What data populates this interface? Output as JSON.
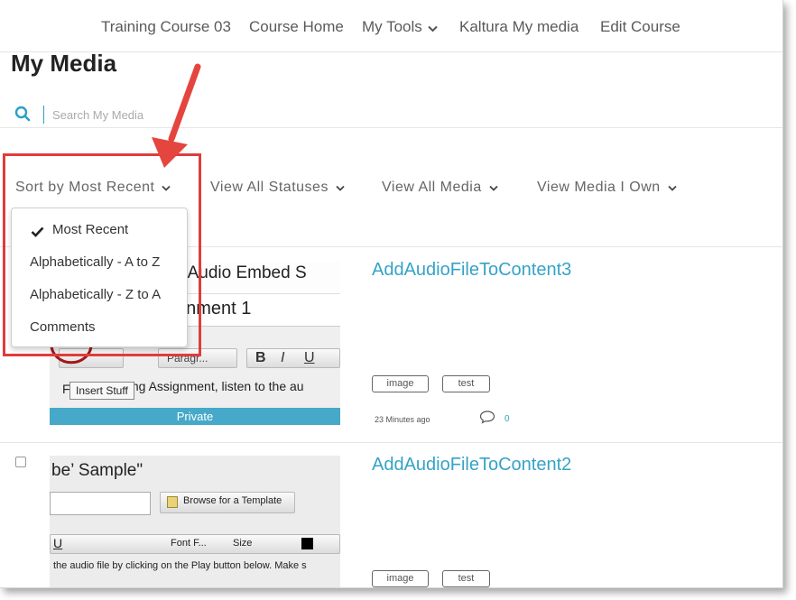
{
  "nav": {
    "items": [
      "Training Course 03",
      "Course Home",
      "My Tools",
      "Kaltura My media",
      "Edit Course"
    ]
  },
  "page": {
    "title": "My Media"
  },
  "search": {
    "placeholder": "Search My Media"
  },
  "filters": {
    "sort": "Sort by Most Recent",
    "statuses": "View All Statuses",
    "media": "View All Media",
    "own": "View Media I Own"
  },
  "sort_menu": {
    "options": [
      "Most Recent",
      "Alphabetically - A to Z",
      "Alphabetically - Z to A",
      "Comments"
    ],
    "selected": "Most Recent"
  },
  "media": [
    {
      "title": "AddAudioFileToContent3",
      "tags": [
        "image",
        "test"
      ],
      "time": "23 Minutes ago",
      "comments": "0",
      "status": "Private",
      "thumb_lines": [
        "n \"Audio Embed S",
        "gnment 1",
        "Paragr...",
        "F",
        "ning Assignment, listen to the au",
        "Insert Stuff"
      ]
    },
    {
      "title": "AddAudioFileToContent2",
      "tags": [
        "image",
        "test"
      ],
      "thumb_lines": [
        "be’ Sample\"",
        "Browse for a Template",
        "Font F...",
        "Size",
        "the audio file by clicking on the Play button below.  Make s"
      ]
    }
  ],
  "colors": {
    "accent": "#35a3c6",
    "highlight": "#e03c3c",
    "private_bar": "#46a9c9"
  },
  "icons": {
    "search": "search-icon",
    "chevron": "chevron-down-icon",
    "check": "check-icon",
    "comment": "comment-icon"
  }
}
